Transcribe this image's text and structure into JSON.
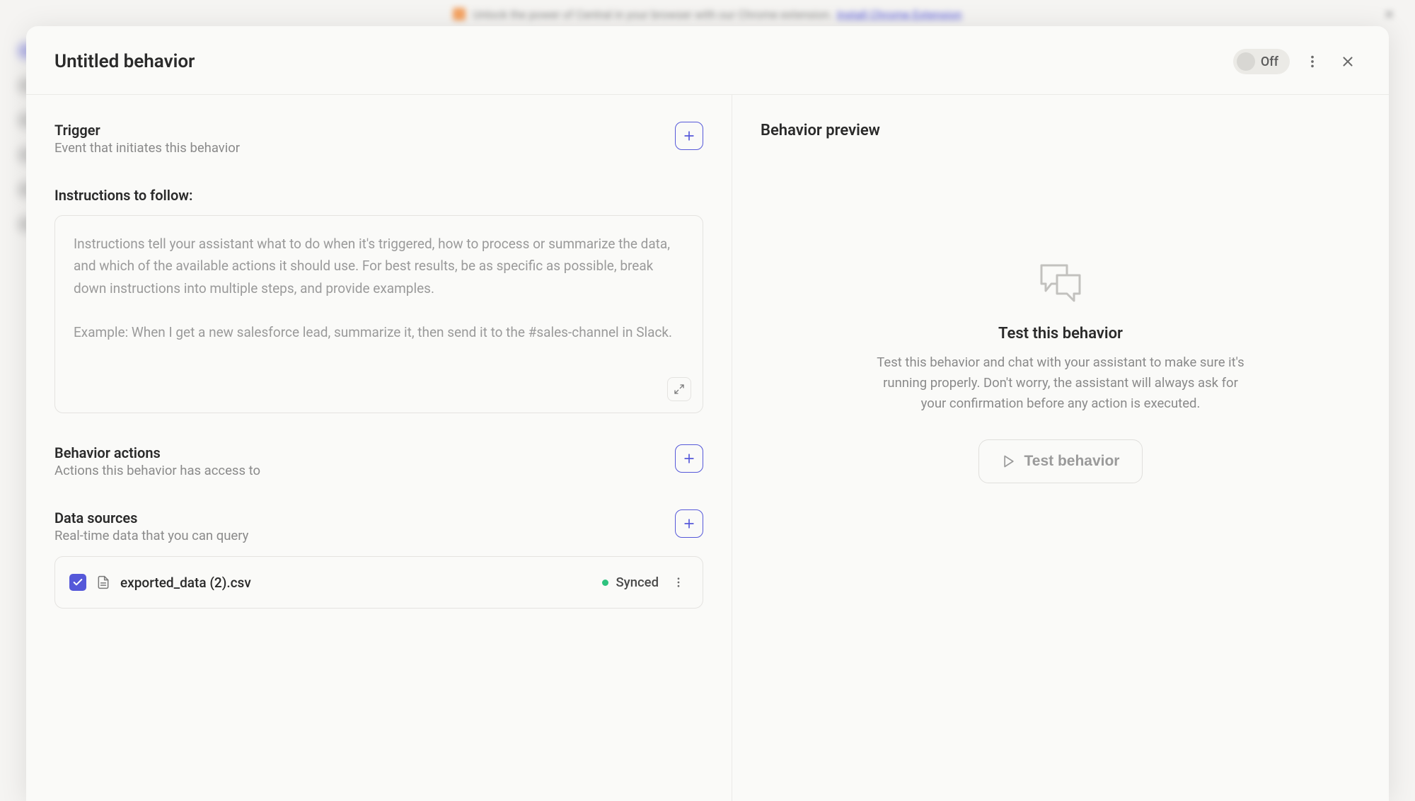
{
  "banner": {
    "text": "Unlock the power of Central in your browser with our Chrome extension.",
    "link": "Install Chrome Extension"
  },
  "header": {
    "title": "Untitled behavior",
    "toggle_label": "Off"
  },
  "trigger": {
    "title": "Trigger",
    "subtitle": "Event that initiates this behavior"
  },
  "instructions": {
    "label": "Instructions to follow:",
    "placeholder": "Instructions tell your assistant what to do when it's triggered, how to process or summarize the data, and which of the available actions it should use. For best results, be as specific as possible, break down instructions into multiple steps, and provide examples.\n\nExample: When I get a new salesforce lead, summarize it, then send it to the #sales-channel in Slack."
  },
  "actions": {
    "title": "Behavior actions",
    "subtitle": "Actions this behavior has access to"
  },
  "data_sources": {
    "title": "Data sources",
    "subtitle": "Real-time data that you can query",
    "items": [
      {
        "name": "exported_data (2).csv",
        "status": "Synced",
        "checked": true
      }
    ]
  },
  "preview": {
    "title": "Behavior preview",
    "heading": "Test this behavior",
    "description": "Test this behavior and chat with your assistant to make sure it's running properly. Don't worry, the assistant will always ask for your confirmation before any action is executed.",
    "button": "Test behavior"
  }
}
